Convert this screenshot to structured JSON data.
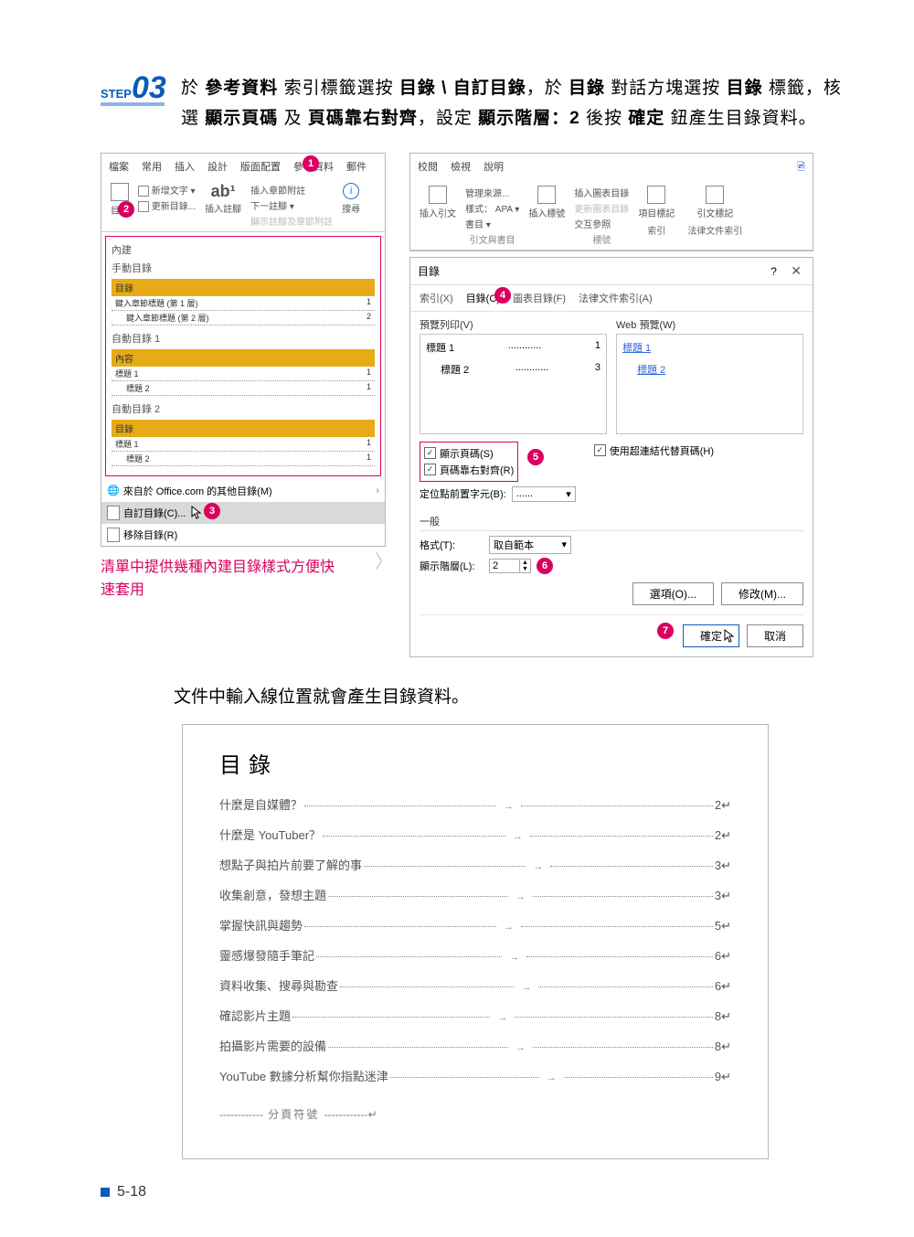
{
  "step": {
    "label": "STEP",
    "number": "03"
  },
  "intro_html": "於 <b>參考資料</b> 索引標籤選按 <b>目錄 \\ 自訂目錄</b>，於 <b>目錄</b> 對話方塊選按 <b>目錄</b> 標籤，核選 <b>顯示頁碼</b> 及 <b>頁碼靠右對齊</b>，設定 <b>顯示階層：2</b> 後按 <b>確定</b> 鈕產生目錄資料。",
  "ribbon": {
    "tabs": [
      "檔案",
      "常用",
      "插入",
      "設計",
      "版面配置",
      "參考資料",
      "郵件",
      "校閱",
      "檢視",
      "說明"
    ],
    "share": "",
    "toc_btn": "目錄",
    "add_text": "新增文字 ▾",
    "update": "更新目錄...",
    "ab": "ab¹",
    "insert_fn": "插入註腳",
    "insert_en": "插入章節附註",
    "next_fn": "下一註腳 ▾",
    "show_notes": "顯示註腳及章節附註",
    "search": "搜尋",
    "insert_cit": "插入引文",
    "manage_src": "管理來源...",
    "style": "樣式：",
    "style_val": "APA",
    "biblio": "書目 ▾",
    "grp_cit": "引文與書目",
    "insert_cap": "插入標號",
    "insert_fig": "插入圖表目錄",
    "update_fig": "更新圖表目錄",
    "crossref": "交互參照",
    "grp_cap": "標號",
    "mark_idx": "項目標記",
    "grp_idx": "索引",
    "mark_cit": "引文標記",
    "grp_leg": "法律文件索引"
  },
  "gallery": {
    "builtin": "內建",
    "manual": "手動目錄",
    "manual_hdr": "目錄",
    "m1": "鍵入章節標題 (第 1 層)",
    "m1p": "1",
    "m2": "鍵入章節標題 (第 2 層)",
    "m2p": "2",
    "auto1": "自動目錄 1",
    "auto1_hdr": "內容",
    "auto2": "自動目錄 2",
    "auto2_hdr": "目錄",
    "h1": "標題 1",
    "h1p": "1",
    "h2": "標題 2",
    "h2p": "1",
    "office": "來自於 Office.com 的其他目錄(M)",
    "custom": "自訂目錄(C)...",
    "remove": "移除目錄(R)"
  },
  "note": "清單中提供幾種內建目錄樣式方便快速套用",
  "dlg": {
    "title": "目錄",
    "help": "?",
    "tabs": {
      "index": "索引(X)",
      "toc": "目錄(C)",
      "fig": "圖表目錄(F)",
      "leg": "法律文件索引(A)"
    },
    "preview_print": "預覽列印(V)",
    "preview_web": "Web 預覽(W)",
    "p1": "標題 1",
    "p1n": "1",
    "p2": "標題 2",
    "p2n": "3",
    "web1": "標題 1",
    "web2": "標題 2",
    "show_pg": "顯示頁碼(S)",
    "right_align": "頁碼靠右對齊(R)",
    "use_hyper": "使用超連結代替頁碼(H)",
    "leader_lbl": "定位點前置字元(B):",
    "leader_val": "......",
    "general": "一般",
    "format_lbl": "格式(T):",
    "format_val": "取自範本",
    "levels_lbl": "顯示階層(L):",
    "levels_val": "2",
    "options": "選項(O)...",
    "modify": "修改(M)...",
    "ok": "確定",
    "cancel": "取消"
  },
  "mid_text": "文件中輸入線位置就會產生目錄資料。",
  "toc": {
    "title": "目錄",
    "lines": [
      {
        "t": "什麼是自媒體？",
        "p": "2↵"
      },
      {
        "t": "什麼是 YouTuber？",
        "p": "2↵"
      },
      {
        "t": "想點子與拍片前要了解的事",
        "p": "3↵"
      },
      {
        "t": "收集創意，發想主題",
        "p": "3↵"
      },
      {
        "t": "掌握快訊與趨勢",
        "p": "5↵"
      },
      {
        "t": "靈感爆發隨手筆記",
        "p": "6↵"
      },
      {
        "t": "資料收集、搜尋與勘查",
        "p": "6↵"
      },
      {
        "t": "確認影片主題",
        "p": "8↵"
      },
      {
        "t": "拍攝影片需要的設備",
        "p": "8↵"
      },
      {
        "t": "YouTube 數據分析幫你指點迷津",
        "p": "9↵"
      }
    ],
    "page_break": "分頁符號"
  },
  "page_num": "5-18"
}
